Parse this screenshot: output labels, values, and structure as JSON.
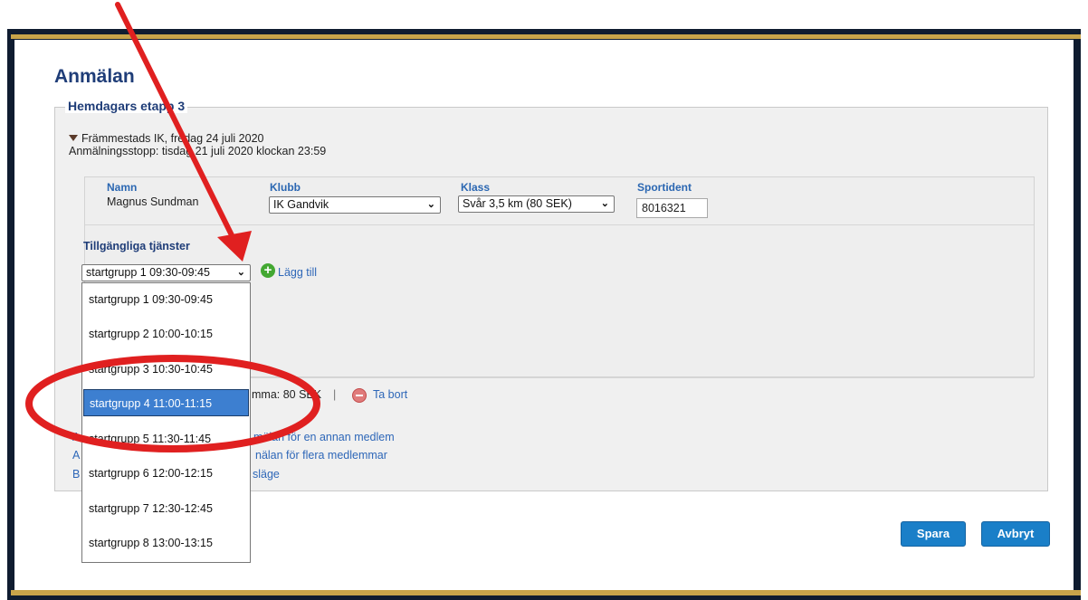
{
  "page_title": "Anmälan",
  "event": {
    "legend": "Hemdagars etapp 3",
    "organizer_line": "Främmestads IK, fredag 24 juli 2020",
    "deadline_line": "Anmälningsstopp: tisdag 21 juli 2020 klockan 23:59"
  },
  "member": {
    "headers": {
      "name": "Namn",
      "club": "Klubb",
      "class": "Klass",
      "sportident": "Sportident"
    },
    "name": "Magnus Sundman",
    "club": "IK Gandvik",
    "class": "Svår 3,5 km (80 SEK)",
    "sportident": "8016321"
  },
  "services": {
    "heading": "Tillgängliga tjänster",
    "selected": "startgrupp 1 09:30-09:45",
    "add_label": "Lägg till",
    "options": [
      "startgrupp 1 09:30-09:45",
      "startgrupp 2 10:00-10:15",
      "startgrupp 3 10:30-10:45",
      "startgrupp 4 11:00-11:15",
      "startgrupp 5 11:30-11:45",
      "startgrupp 6 12:00-12:15",
      "startgrupp 7 12:30-12:45",
      "startgrupp 8 13:00-13:15"
    ],
    "highlighted_index": 3
  },
  "summary": {
    "sum_text": "mma: 80 SEK",
    "separator": "|",
    "remove_label": "Ta bort"
  },
  "links": {
    "add_other_prefix": "A",
    "add_other_suffix": "mälan för en annan medlem",
    "add_multiple_prefix": "A",
    "add_multiple_suffix": "nälan för flera medlemmar",
    "mode_prefix": "B",
    "mode_suffix": "släge"
  },
  "buttons": {
    "save": "Spara",
    "cancel": "Avbryt"
  },
  "colors": {
    "heading_blue": "#1f3d78",
    "link_blue": "#2e67b8",
    "button_blue": "#1a7fc8",
    "annotation_red": "#e02020",
    "frame_gold": "#c8a44a",
    "selected_option": "#3d7fd0"
  },
  "annotations": {
    "arrow": "red-arrow",
    "circle": "red-ellipse"
  }
}
